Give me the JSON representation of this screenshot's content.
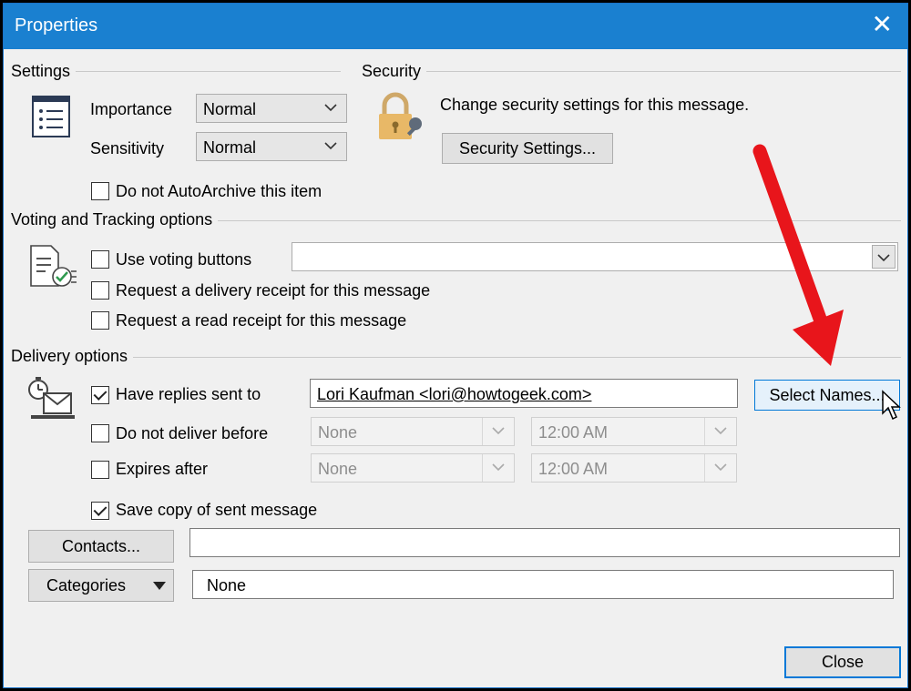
{
  "window": {
    "title": "Properties",
    "close_glyph": "✕"
  },
  "settings": {
    "group_title": "Settings",
    "importance_label": "Importance",
    "importance_value": "Normal",
    "sensitivity_label": "Sensitivity",
    "sensitivity_value": "Normal",
    "autoarchive_label": "Do not AutoArchive this item",
    "autoarchive_checked": false
  },
  "security": {
    "group_title": "Security",
    "description": "Change security settings for this message.",
    "button_label": "Security Settings..."
  },
  "voting": {
    "group_title": "Voting and Tracking options",
    "use_voting_label": "Use voting buttons",
    "voting_value": "",
    "delivery_receipt_label": "Request a delivery receipt for this message",
    "read_receipt_label": "Request a read receipt for this message"
  },
  "delivery": {
    "group_title": "Delivery options",
    "replies_label": "Have replies sent to",
    "replies_checked": true,
    "replies_value": "Lori Kaufman <lori@howtogeek.com>",
    "select_names_label": "Select Names...",
    "not_before_label": "Do not deliver before",
    "not_before_date": "None",
    "not_before_time": "12:00 AM",
    "expires_label": "Expires after",
    "expires_date": "None",
    "expires_time": "12:00 AM",
    "save_copy_label": "Save copy of sent message",
    "save_copy_checked": true
  },
  "contacts": {
    "button_label": "Contacts...",
    "value": ""
  },
  "categories": {
    "button_label": "Categories",
    "value": "None"
  },
  "footer": {
    "close_label": "Close"
  },
  "colors": {
    "titlebar": "#1a80d0",
    "accent": "#0078d7",
    "annotation_arrow": "#e8151b"
  }
}
